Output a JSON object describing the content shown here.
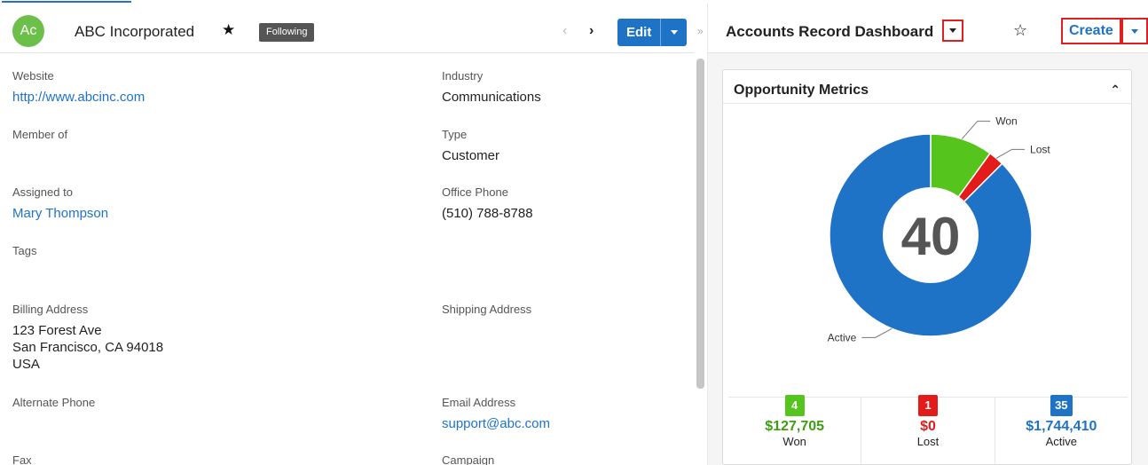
{
  "record": {
    "initials": "Ac",
    "name": "ABC Incorporated",
    "following_badge": "Following",
    "edit_label": "Edit",
    "colors": {
      "avatar": "#6cc04a",
      "edit_button": "#1f73c7"
    }
  },
  "fields": {
    "website": {
      "label": "Website",
      "value": "http://www.abcinc.com"
    },
    "industry": {
      "label": "Industry",
      "value": "Communications"
    },
    "member_of": {
      "label": "Member of",
      "value": ""
    },
    "type": {
      "label": "Type",
      "value": "Customer"
    },
    "assigned_to": {
      "label": "Assigned to",
      "value": "Mary Thompson"
    },
    "office_phone": {
      "label": "Office Phone",
      "value": "(510) 788-8788"
    },
    "tags": {
      "label": "Tags",
      "value": ""
    },
    "billing_address": {
      "label": "Billing Address",
      "line1": "123 Forest Ave",
      "line2": "San Francisco, CA  94018",
      "line3": "USA"
    },
    "shipping_address": {
      "label": "Shipping Address",
      "value": ""
    },
    "alternate_phone": {
      "label": "Alternate Phone",
      "value": ""
    },
    "email_address": {
      "label": "Email Address",
      "value": "support@abc.com"
    },
    "fax": {
      "label": "Fax"
    },
    "campaign": {
      "label": "Campaign"
    }
  },
  "dashboard": {
    "title": "Accounts Record Dashboard",
    "create_label": "Create",
    "card_title": "Opportunity Metrics",
    "total": "40",
    "labels": {
      "won": "Won",
      "lost": "Lost",
      "active": "Active"
    }
  },
  "metrics": [
    {
      "count": "4",
      "amount": "$127,705",
      "label": "Won",
      "color": "#55c51e",
      "amount_color": "#3f9d12"
    },
    {
      "count": "1",
      "amount": "$0",
      "label": "Lost",
      "color": "#e31b1b",
      "amount_color": "#e31b1b"
    },
    {
      "count": "35",
      "amount": "$1,744,410",
      "label": "Active",
      "color": "#1f73c7",
      "amount_color": "#1f73c7"
    }
  ],
  "chart_data": {
    "type": "pie",
    "categories": [
      "Won",
      "Lost",
      "Active"
    ],
    "values": [
      4,
      1,
      35
    ],
    "colors": [
      "#55c51e",
      "#e31b1b",
      "#1f73c7"
    ],
    "center_label": "40",
    "title": "",
    "legend": "none"
  }
}
